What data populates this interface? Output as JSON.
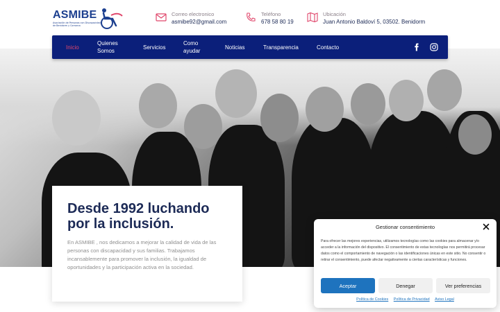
{
  "logo": {
    "brand": "ASMIBE",
    "tagline": "Asociación de Personas con Discapacidad de Benidorm y Comarca"
  },
  "contacts": [
    {
      "label": "Correo electronico",
      "value": "asmibe92@gmail.com",
      "icon": "mail-icon"
    },
    {
      "label": "Teléfono",
      "value": "678 58 80 19",
      "icon": "phone-icon"
    },
    {
      "label": "Ubicación",
      "value": "Juan Antonio Baldoví 5, 03502. Benidorm",
      "icon": "map-icon"
    }
  ],
  "nav": {
    "items": [
      "Inicio",
      "Quienes Somos",
      "Servicios",
      "Como ayudar",
      "Noticias",
      "Transparencia",
      "Contacto"
    ],
    "active": "Inicio",
    "social": [
      "facebook-icon",
      "instagram-icon"
    ]
  },
  "hero": {
    "title": "Desde 1992 luchando por la inclusión.",
    "text": "En ASMIBE , nos dedicamos a mejorar la calidad de vida de las personas con discapacidad y sus familias. Trabajamos incansablemente para promover la inclusión, la igualdad de oportunidades y la participación activa en la sociedad."
  },
  "cookie": {
    "title": "Gestionar consentimiento",
    "text": "Para ofrecer las mejores experiencias, utilizamos tecnologías como las cookies para almacenar y/o acceder a la información del dispositivo. El consentimiento de estas tecnologías nos permitirá procesar datos como el comportamiento de navegación o las identificaciones únicas en este sitio. No consentir o retirar el consentimiento, puede afectar negativamente a ciertas características y funciones.",
    "accept": "Aceptar",
    "deny": "Denegar",
    "prefs": "Ver preferencias",
    "links": [
      "Política de Cookies",
      "Política de Privacidad",
      "Aviso Legal"
    ]
  },
  "colors": {
    "navy": "#0b1f7a",
    "accent": "#e0466b",
    "button": "#1e73be"
  }
}
